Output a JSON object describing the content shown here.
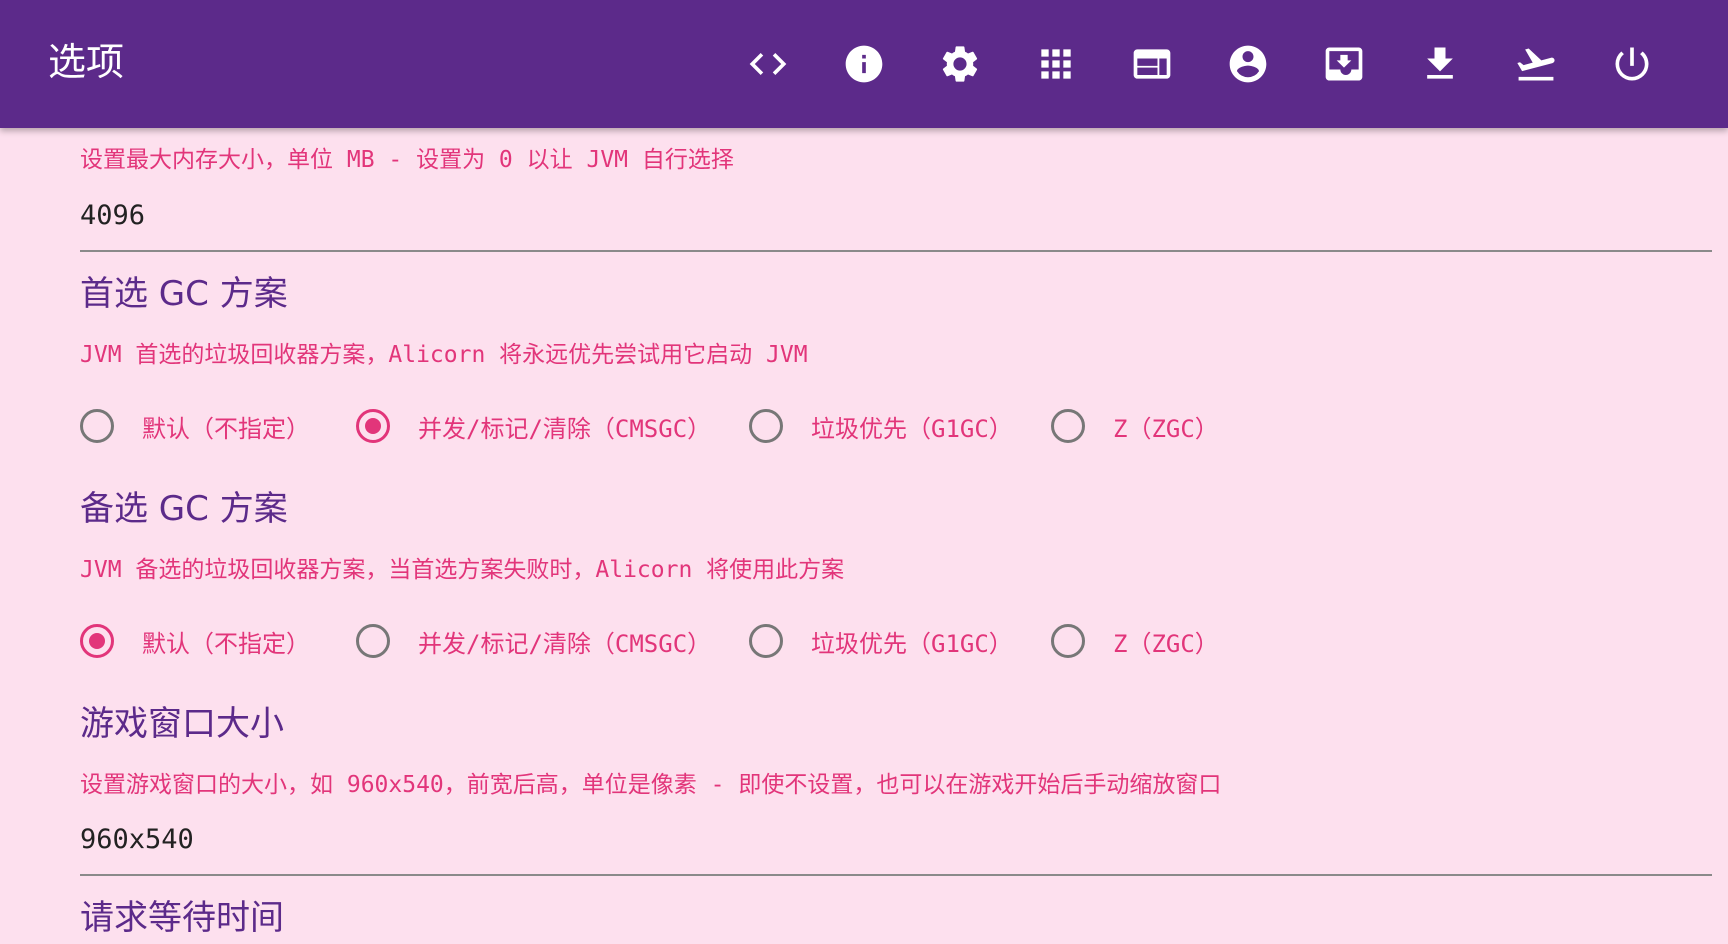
{
  "appbar": {
    "title": "选项",
    "icons": [
      "code-icon",
      "info-icon",
      "settings-icon",
      "apps-grid-icon",
      "web-window-icon",
      "account-circle-icon",
      "inbox-icon",
      "download-icon",
      "flight-takeoff-icon",
      "power-icon"
    ]
  },
  "memory": {
    "description": "设置最大内存大小，单位 MB - 设置为 0 以让 JVM 自行选择",
    "value": "4096"
  },
  "preferred_gc": {
    "title": "首选 GC 方案",
    "description": "JVM 首选的垃圾回收器方案，Alicorn 将永远优先尝试用它启动 JVM",
    "options": [
      "默认（不指定）",
      "并发/标记/清除（CMSGC）",
      "垃圾优先（G1GC）",
      "Z（ZGC）"
    ],
    "selected": "并发/标记/清除（CMSGC）"
  },
  "fallback_gc": {
    "title": "备选 GC 方案",
    "description": "JVM 备选的垃圾回收器方案，当首选方案失败时，Alicorn 将使用此方案",
    "options": [
      "默认（不指定）",
      "并发/标记/清除（CMSGC）",
      "垃圾优先（G1GC）",
      "Z（ZGC）"
    ],
    "selected": "默认（不指定）"
  },
  "window_size": {
    "title": "游戏窗口大小",
    "description": "设置游戏窗口的大小，如 960x540，前宽后高，单位是像素 - 即使不设置，也可以在游戏开始后手动缩放窗口",
    "value": "960x540"
  },
  "request_timeout": {
    "title": "请求等待时间"
  },
  "colors": {
    "appbar": "#5c2a8a",
    "background": "#fde0ee",
    "accent": "#e2357a",
    "heading": "#5c2a8a"
  }
}
